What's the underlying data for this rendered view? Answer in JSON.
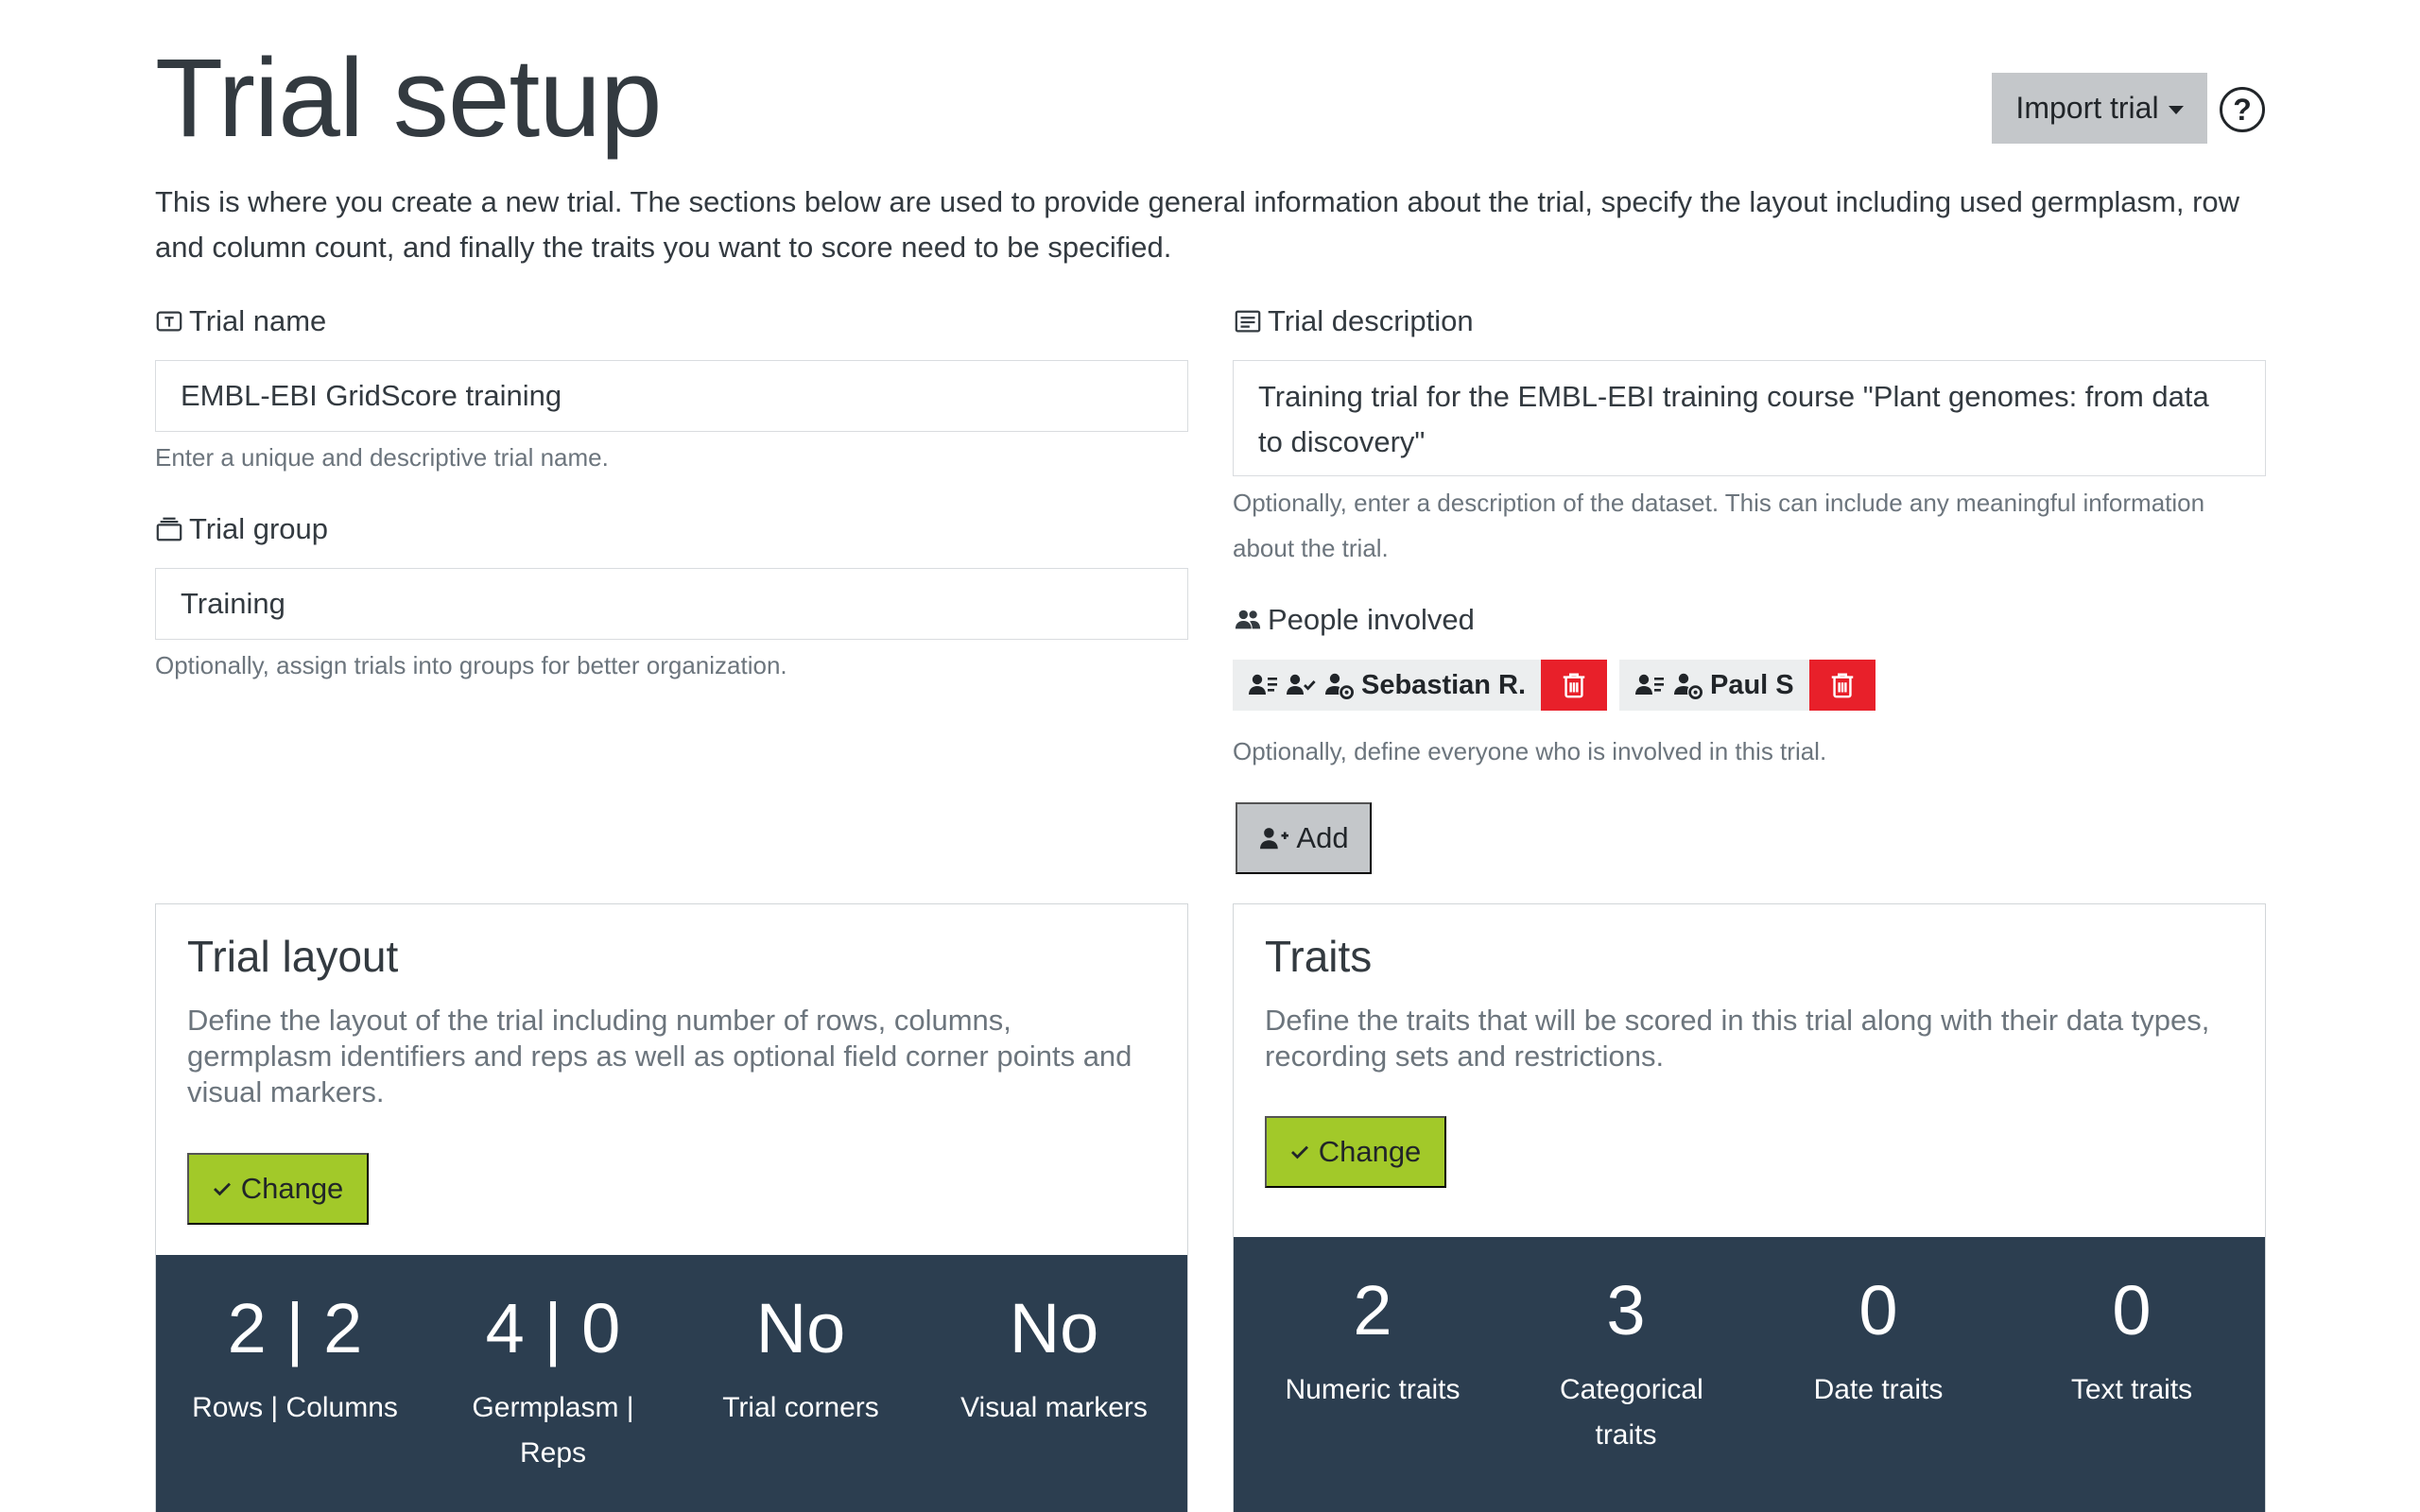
{
  "header": {
    "title": "Trial setup",
    "import_label": "Import trial",
    "help_symbol": "?"
  },
  "intro": "This is where you create a new trial. The sections below are used to provide general information about the trial, specify the layout including used germplasm, row and column count, and finally the traits you want to score need to be specified.",
  "trial_name": {
    "label": "Trial name",
    "value": "EMBL-EBI GridScore training",
    "help": "Enter a unique and descriptive trial name."
  },
  "trial_group": {
    "label": "Trial group",
    "value": "Training",
    "help": "Optionally, assign trials into groups for better organization."
  },
  "trial_description": {
    "label": "Trial description",
    "value": "Training trial for the EMBL-EBI training course \"Plant genomes: from data to discovery\"",
    "help": "Optionally, enter a description of the dataset. This can include any meaningful information about the trial."
  },
  "people": {
    "label": "People involved",
    "items": [
      {
        "name": "Sebastian R."
      },
      {
        "name": "Paul S"
      }
    ],
    "help": "Optionally, define everyone who is involved in this trial.",
    "add_label": "Add"
  },
  "layout_card": {
    "title": "Trial layout",
    "description": "Define the layout of the trial including number of rows, columns, germplasm identifiers and reps as well as optional field corner points and visual markers.",
    "button_label": "Change",
    "stats": [
      {
        "value": "2 | 2",
        "label": "Rows | Columns"
      },
      {
        "value": "4 | 0",
        "label": "Germplasm | Reps"
      },
      {
        "value": "No",
        "label": "Trial corners"
      },
      {
        "value": "No",
        "label": "Visual markers"
      }
    ]
  },
  "traits_card": {
    "title": "Traits",
    "description": "Define the traits that will be scored in this trial along with their data types, recording sets and restrictions.",
    "button_label": "Change",
    "stats": [
      {
        "value": "2",
        "label": "Numeric traits"
      },
      {
        "value": "3",
        "label": "Categorical traits"
      },
      {
        "value": "0",
        "label": "Date traits"
      },
      {
        "value": "0",
        "label": "Text traits"
      }
    ]
  },
  "colors": {
    "accent_green": "#a2c929",
    "danger_red": "#e8202a",
    "stats_bg": "#2c3e50",
    "button_grey": "#c4c7ca"
  },
  "icons": [
    "tag-icon",
    "group-box-icon",
    "description-icon",
    "people-icon",
    "person-list-icon",
    "person-check-icon",
    "person-gear-icon",
    "trash-icon",
    "person-add-icon",
    "check-icon",
    "help-circle-icon"
  ]
}
